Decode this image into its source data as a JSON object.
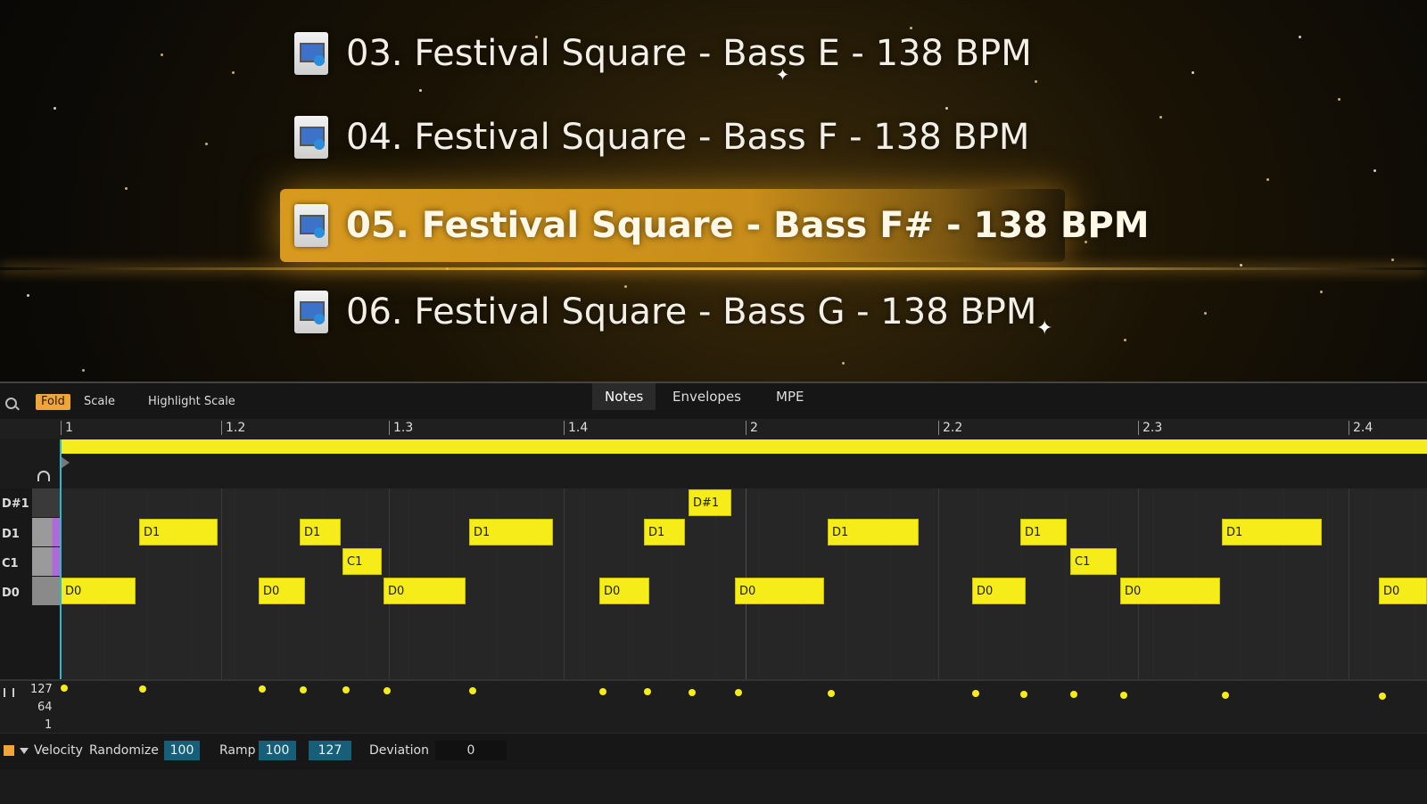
{
  "file_browser": {
    "items": [
      {
        "label": "03. Festival Square - Bass E - 138 BPM",
        "selected": false
      },
      {
        "label": "04. Festival Square - Bass F - 138 BPM",
        "selected": false
      },
      {
        "label": "05. Festival Square - Bass F# - 138 BPM",
        "selected": true
      },
      {
        "label": "06. Festival Square - Bass G - 138 BPM",
        "selected": false
      }
    ]
  },
  "toolbar": {
    "fold": "Fold",
    "scale": "Scale",
    "highlight_scale": "Highlight Scale",
    "tabs": [
      "Notes",
      "Envelopes",
      "MPE"
    ],
    "active_tab": "Notes"
  },
  "ruler": [
    "1",
    "1.2",
    "1.3",
    "1.4",
    "2",
    "2.2",
    "2.3",
    "2.4"
  ],
  "keys": [
    "D#1",
    "D1",
    "C1",
    "D0"
  ],
  "notes": [
    {
      "pitch": "D0",
      "label": "D0"
    },
    {
      "pitch": "D1",
      "label": "D1"
    },
    {
      "pitch": "D0",
      "label": "D0"
    },
    {
      "pitch": "D1",
      "label": "D1"
    },
    {
      "pitch": "C1",
      "label": "C1"
    },
    {
      "pitch": "D0",
      "label": "D0"
    },
    {
      "pitch": "D1",
      "label": "D1"
    },
    {
      "pitch": "D0",
      "label": "D0"
    },
    {
      "pitch": "D1",
      "label": "D1"
    },
    {
      "pitch": "D#1",
      "label": "D#1"
    },
    {
      "pitch": "D0",
      "label": "D0"
    },
    {
      "pitch": "D1",
      "label": "D1"
    },
    {
      "pitch": "D0",
      "label": "D0"
    },
    {
      "pitch": "D1",
      "label": "D1"
    },
    {
      "pitch": "C1",
      "label": "C1"
    },
    {
      "pitch": "D0",
      "label": "D0"
    },
    {
      "pitch": "D1",
      "label": "D1"
    },
    {
      "pitch": "D0",
      "label": "D0"
    }
  ],
  "velocity_scale": [
    "127",
    "64",
    "1"
  ],
  "bottom_bar": {
    "velocity": "Velocity",
    "randomize": "Randomize",
    "randomize_value": "100",
    "ramp": "Ramp",
    "ramp_start": "100",
    "ramp_end": "127",
    "deviation": "Deviation",
    "deviation_value": "0"
  },
  "colors": {
    "note": "#f5ec1a",
    "accent": "#f0a53a",
    "playhead": "#2fb8c9"
  }
}
